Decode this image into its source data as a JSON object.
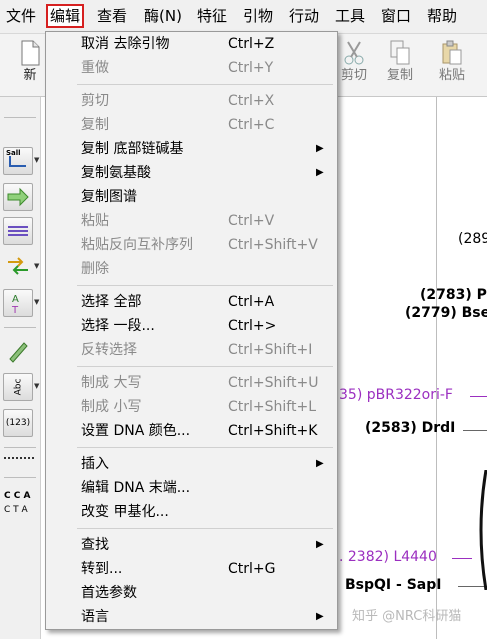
{
  "menubar": {
    "items": [
      {
        "label": "文件"
      },
      {
        "label": "编辑"
      },
      {
        "label": "查看"
      },
      {
        "label": "酶(N)"
      },
      {
        "label": "特征"
      },
      {
        "label": "引物"
      },
      {
        "label": "行动"
      },
      {
        "label": "工具"
      },
      {
        "label": "窗口"
      },
      {
        "label": "帮助"
      }
    ]
  },
  "toolbar": {
    "new_label": "新",
    "cut_label": "剪切",
    "copy_label": "复制",
    "paste_label": "粘贴"
  },
  "sidebar": {
    "restriction_label": "Sall",
    "abc_label": "Abc",
    "num_label": "(123)",
    "cca_label": "C C A",
    "cta_label": "C T A"
  },
  "map": {
    "labels": [
      {
        "text": "(289"
      },
      {
        "text": "(2783)  P"
      },
      {
        "text": "(2779)  Bse"
      },
      {
        "text": "35)  pBR322ori-F"
      },
      {
        "text": "(2583)  DrdI"
      },
      {
        "text": ". 2382)  L4440"
      },
      {
        "text": "BspQI - SapI"
      }
    ],
    "colors": {
      "feature": "#9b2fc0",
      "highlight": "#d62020"
    }
  },
  "edit_menu": {
    "items": [
      {
        "label": "取消 去除引物",
        "shortcut": "Ctrl+Z",
        "disabled": false,
        "submenu": false
      },
      {
        "label": "重做",
        "shortcut": "Ctrl+Y",
        "disabled": true,
        "submenu": false
      },
      {
        "label": "剪切",
        "shortcut": "Ctrl+X",
        "disabled": true,
        "submenu": false
      },
      {
        "label": "复制",
        "shortcut": "Ctrl+C",
        "disabled": true,
        "submenu": false
      },
      {
        "label": "复制 底部链碱基",
        "shortcut": "",
        "disabled": false,
        "submenu": true
      },
      {
        "label": "复制氨基酸",
        "shortcut": "",
        "disabled": false,
        "submenu": true
      },
      {
        "label": "复制图谱",
        "shortcut": "",
        "disabled": false,
        "submenu": false
      },
      {
        "label": "粘贴",
        "shortcut": "Ctrl+V",
        "disabled": true,
        "submenu": false
      },
      {
        "label": "粘贴反向互补序列",
        "shortcut": "Ctrl+Shift+V",
        "disabled": true,
        "submenu": false
      },
      {
        "label": "删除",
        "shortcut": "",
        "disabled": true,
        "submenu": false
      },
      {
        "label": "选择 全部",
        "shortcut": "Ctrl+A",
        "disabled": false,
        "submenu": false
      },
      {
        "label": "选择 一段...",
        "shortcut": "Ctrl+>",
        "disabled": false,
        "submenu": false
      },
      {
        "label": "反转选择",
        "shortcut": "Ctrl+Shift+I",
        "disabled": true,
        "submenu": false
      },
      {
        "label": "制成 大写",
        "shortcut": "Ctrl+Shift+U",
        "disabled": true,
        "submenu": false
      },
      {
        "label": "制成 小写",
        "shortcut": "Ctrl+Shift+L",
        "disabled": true,
        "submenu": false
      },
      {
        "label": "设置 DNA 颜色...",
        "shortcut": "Ctrl+Shift+K",
        "disabled": false,
        "submenu": false
      },
      {
        "label": "插入",
        "shortcut": "",
        "disabled": false,
        "submenu": true
      },
      {
        "label": "编辑 DNA 末端...",
        "shortcut": "",
        "disabled": false,
        "submenu": false
      },
      {
        "label": "改变 甲基化...",
        "shortcut": "",
        "disabled": false,
        "submenu": false
      },
      {
        "label": "查找",
        "shortcut": "",
        "disabled": false,
        "submenu": true
      },
      {
        "label": "转到...",
        "shortcut": "Ctrl+G",
        "disabled": false,
        "submenu": false
      },
      {
        "label": "首选参数",
        "shortcut": "",
        "disabled": false,
        "submenu": false
      },
      {
        "label": "语言",
        "shortcut": "",
        "disabled": false,
        "submenu": true
      }
    ]
  },
  "watermark": "知乎 @NRC科研猫"
}
